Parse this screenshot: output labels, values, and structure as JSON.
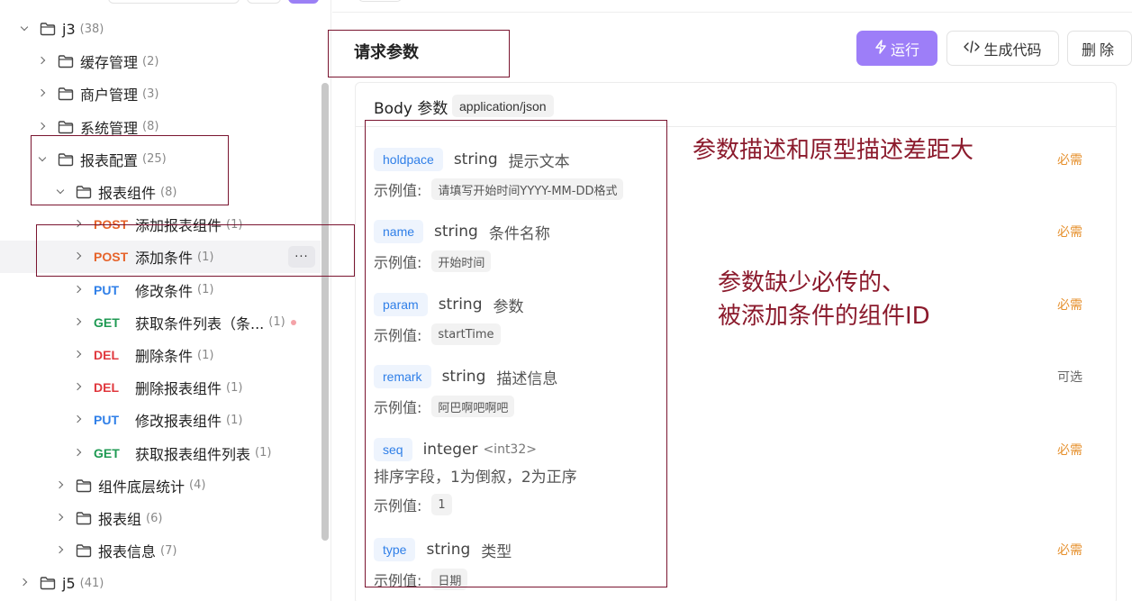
{
  "sidebar": {
    "tree": [
      {
        "kind": "folder",
        "expanded": true,
        "level": 0,
        "label": "j3",
        "count": "(38)"
      },
      {
        "kind": "folder",
        "expanded": false,
        "level": 1,
        "label": "缓存管理",
        "count": "(2)"
      },
      {
        "kind": "folder",
        "expanded": false,
        "level": 1,
        "label": "商户管理",
        "count": "(3)"
      },
      {
        "kind": "folder",
        "expanded": false,
        "level": 1,
        "label": "系统管理",
        "count": "(8)"
      },
      {
        "kind": "folder",
        "expanded": true,
        "level": 1,
        "label": "报表配置",
        "count": "(25)"
      },
      {
        "kind": "folder",
        "expanded": true,
        "level": 2,
        "label": "报表组件",
        "count": "(8)"
      },
      {
        "kind": "endpoint",
        "method": "POST",
        "mclass": "post",
        "label": "添加报表组件",
        "count": "(1)"
      },
      {
        "kind": "endpoint",
        "method": "POST",
        "mclass": "post",
        "label": "添加条件",
        "count": "(1)",
        "selected": true,
        "more": "···"
      },
      {
        "kind": "endpoint",
        "method": "PUT",
        "mclass": "put",
        "label": "修改条件",
        "count": "(1)"
      },
      {
        "kind": "endpoint",
        "method": "GET",
        "mclass": "get",
        "label": "获取条件列表（条...",
        "count": "(1)",
        "dot": true
      },
      {
        "kind": "endpoint",
        "method": "DEL",
        "mclass": "del",
        "label": "删除条件",
        "count": "(1)"
      },
      {
        "kind": "endpoint",
        "method": "DEL",
        "mclass": "del",
        "label": "删除报表组件",
        "count": "(1)"
      },
      {
        "kind": "endpoint",
        "method": "PUT",
        "mclass": "put",
        "label": "修改报表组件",
        "count": "(1)"
      },
      {
        "kind": "endpoint",
        "method": "GET",
        "mclass": "get",
        "label": "获取报表组件列表",
        "count": "(1)"
      },
      {
        "kind": "folder",
        "expanded": false,
        "level": 2,
        "label": "组件底层统计",
        "count": "(4)"
      },
      {
        "kind": "folder",
        "expanded": false,
        "level": 2,
        "label": "报表组",
        "count": "(6)"
      },
      {
        "kind": "folder",
        "expanded": false,
        "level": 2,
        "label": "报表信息",
        "count": "(7)"
      },
      {
        "kind": "folder",
        "expanded": false,
        "level": 0,
        "label": "j5",
        "count": "(41)"
      }
    ]
  },
  "main": {
    "section_title": "请求参数",
    "buttons": {
      "run": "运行",
      "gen": "生成代码",
      "del": "删除"
    },
    "body_title": "Body 参数",
    "content_type": "application/json",
    "example_label": "示例值:",
    "params": [
      {
        "name": "holdpace",
        "type": "string",
        "desc": "提示文本",
        "example": "请填写开始时间YYYY-MM-DD格式",
        "req": "必需"
      },
      {
        "name": "name",
        "type": "string",
        "desc": "条件名称",
        "example": "开始时间",
        "req": "必需"
      },
      {
        "name": "param",
        "type": "string",
        "desc": "参数",
        "example": "startTime",
        "req": "必需"
      },
      {
        "name": "remark",
        "type": "string",
        "desc": "描述信息",
        "example": "阿巴啊吧啊吧",
        "req": "可选",
        "optional": true
      },
      {
        "name": "seq",
        "type": "integer",
        "fmt": "<int32>",
        "desc_line": "排序字段，1为倒叙，2为正序",
        "example": "1",
        "req": "必需"
      },
      {
        "name": "type",
        "type": "string",
        "desc": "类型",
        "example": "日期",
        "req": "必需"
      }
    ]
  },
  "annotations": {
    "note1": "参数描述和原型描述差距大",
    "note2_line1": "参数缺少必传的、",
    "note2_line2": "被添加条件的组件ID"
  },
  "colors": {
    "accent": "#9d7ef8",
    "post": "#e6632a",
    "put": "#2f7fe8",
    "get": "#1f9a53",
    "del": "#e0383e",
    "required": "#e6902d",
    "annotation": "#8b1a2c"
  }
}
